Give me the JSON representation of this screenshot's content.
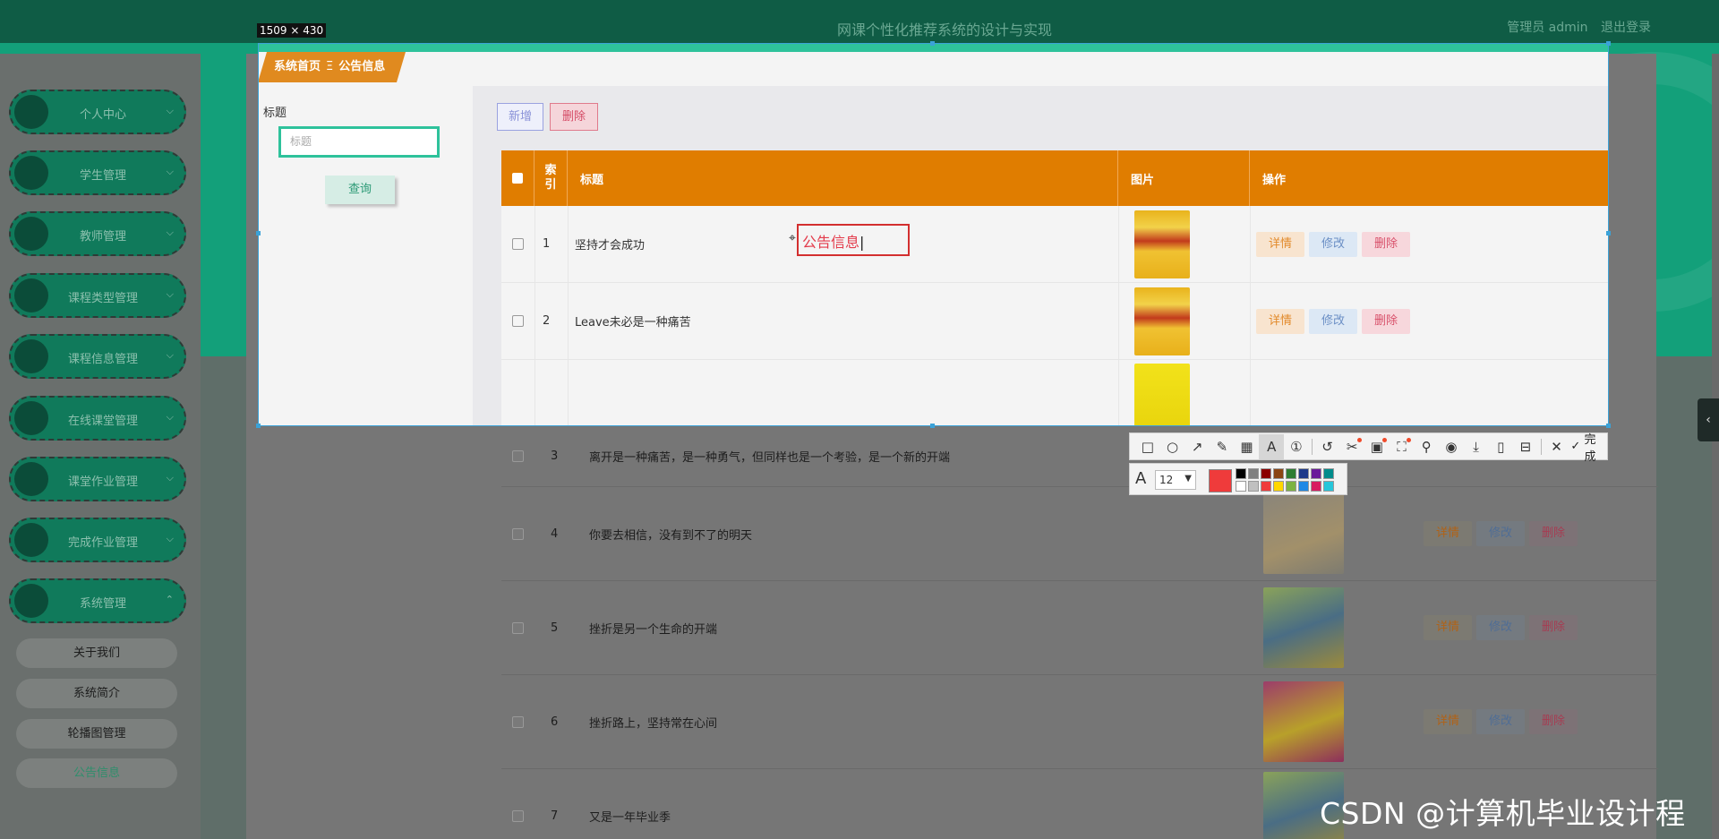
{
  "app": {
    "title": "网课个性化推荐系统的设计与实现",
    "user": "管理员 admin",
    "logout": "退出登录"
  },
  "sidebar": {
    "items": [
      {
        "label": "个人中心",
        "chevron": "v"
      },
      {
        "label": "学生管理",
        "chevron": "v"
      },
      {
        "label": "教师管理",
        "chevron": "v"
      },
      {
        "label": "课程类型管理",
        "chevron": "v"
      },
      {
        "label": "课程信息管理",
        "chevron": "v"
      },
      {
        "label": "在线课堂管理",
        "chevron": "v"
      },
      {
        "label": "课堂作业管理",
        "chevron": "v"
      },
      {
        "label": "完成作业管理",
        "chevron": "v"
      },
      {
        "label": "系统管理",
        "chevron": "^"
      }
    ],
    "sub_items": [
      {
        "label": "关于我们"
      },
      {
        "label": "系统简介"
      },
      {
        "label": "轮播图管理"
      },
      {
        "label": "公告信息"
      }
    ]
  },
  "breadcrumb": {
    "home": "系统首页",
    "sep": "Ξ",
    "current": "公告信息"
  },
  "filter": {
    "label": "标题",
    "placeholder": "标题",
    "query": "查询"
  },
  "actions": {
    "add": "新增",
    "delete": "删除"
  },
  "table": {
    "columns": [
      "",
      "索引",
      "标题",
      "图片",
      "操作"
    ],
    "index_header_line1": "索",
    "index_header_line2": "引",
    "row_ops": {
      "detail": "详情",
      "edit": "修改",
      "delete": "删除"
    },
    "rows": [
      {
        "index": "1",
        "title": "坚持才会成功"
      },
      {
        "index": "2",
        "title": "Leave未必是一种痛苦"
      },
      {
        "index": "3",
        "title": "离开是一种痛苦，是一种勇气，但同样也是一个考验，是一个新的开端"
      },
      {
        "index": "4",
        "title": "你要去相信，没有到不了的明天"
      },
      {
        "index": "5",
        "title": "挫折是另一个生命的开端"
      },
      {
        "index": "6",
        "title": "挫折路上，坚持常在心间"
      },
      {
        "index": "7",
        "title": "又是一年毕业季"
      }
    ]
  },
  "screenshot_tool": {
    "size_label": "1509 × 430",
    "annotation_text": "公告信息",
    "font_size": "12",
    "done_label": "完成",
    "current_color": "#ef3b3b",
    "palette": [
      "#000000",
      "#808080",
      "#8b0000",
      "#8b4513",
      "#2e7d32",
      "#1e3a8a",
      "#6a1b9a",
      "#008b8b",
      "#ffffff",
      "#c0c0c0",
      "#ef3b3b",
      "#ffd700",
      "#7cb342",
      "#1e88e5",
      "#d81b60",
      "#26c6da"
    ],
    "tools": [
      "rect-icon",
      "ellipse-icon",
      "arrow-icon",
      "pencil-icon",
      "mosaic-icon",
      "text-icon",
      "number-icon",
      "undo-icon",
      "cut-icon",
      "ocr-icon",
      "scan-icon",
      "pin-icon",
      "record-icon",
      "download-icon",
      "mobile-icon",
      "save-icon",
      "close-icon",
      "check-icon"
    ]
  },
  "watermark": "CSDN @计算机毕业设计程"
}
